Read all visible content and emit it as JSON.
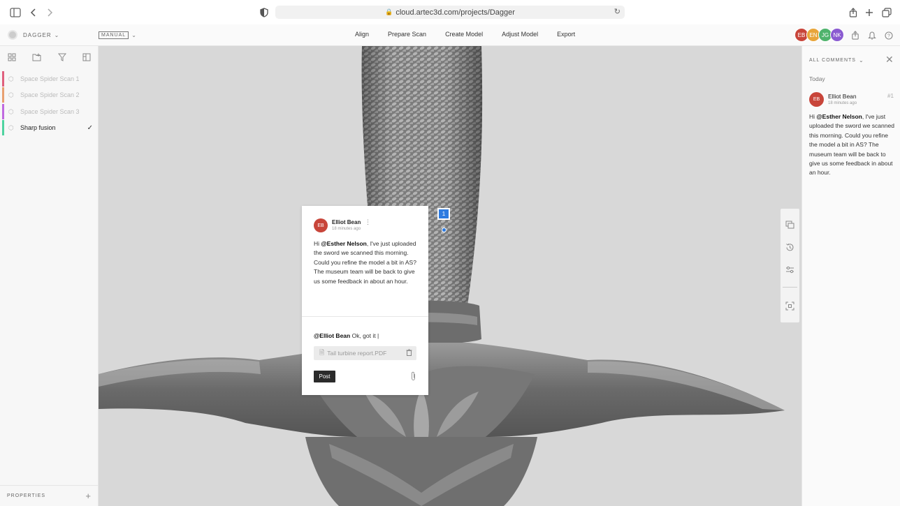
{
  "browser": {
    "url": "cloud.artec3d.com/projects/Dagger"
  },
  "header": {
    "project_name": "DAGGER",
    "mode": "MANUAL",
    "menu": [
      "Align",
      "Prepare Scan",
      "Create Model",
      "Adjust Model",
      "Export"
    ],
    "avatars": [
      {
        "initials": "EB",
        "color": "#c8453a"
      },
      {
        "initials": "EN",
        "color": "#e8a53a"
      },
      {
        "initials": "JG",
        "color": "#4fb36c"
      },
      {
        "initials": "NK",
        "color": "#8a5bd1"
      }
    ]
  },
  "sidebar": {
    "items": [
      {
        "label": "Space Spider Scan 1",
        "color": "#e0607e",
        "dim": true
      },
      {
        "label": "Space Spider Scan 2",
        "color": "#e8a070",
        "dim": true
      },
      {
        "label": "Space Spider Scan 3",
        "color": "#c06ae0",
        "dim": true
      },
      {
        "label": "Sharp fusion",
        "color": "#4fd3a0",
        "dim": false,
        "checked": true
      }
    ],
    "properties_label": "PROPERTIES"
  },
  "comment_card": {
    "initials": "EB",
    "author": "Elliot Bean",
    "time": "18 minutes ago",
    "body_prefix": "Hi ",
    "mention": "@Esther Nelson",
    "body_suffix": ", I've just uploaded the sword we scanned this morning. Could you refine the model a bit in AS? The museum team will be back to give us some feedback in about an hour.",
    "reply_mention": "@Elliot Bean",
    "reply_text": " Ok, got it |",
    "attachment": "Tail turbine report.PDF",
    "post_label": "Post"
  },
  "marker": {
    "number": "1"
  },
  "comments_panel": {
    "filter_label": "ALL COMMENTS",
    "group_label": "Today",
    "initials": "EB",
    "author": "Elliot Bean",
    "time": "18 minutes ago",
    "number": "#1",
    "body_prefix": "Hi ",
    "mention": "@Esther Nelson",
    "body_suffix": ", I've just uploaded the sword we scanned this morning. Could you refine the model a bit in AS? The museum team will be back to give us some feedback in about an hour."
  },
  "colors": {
    "accent": "#2d7be0",
    "post_button": "#2b2b2b"
  }
}
